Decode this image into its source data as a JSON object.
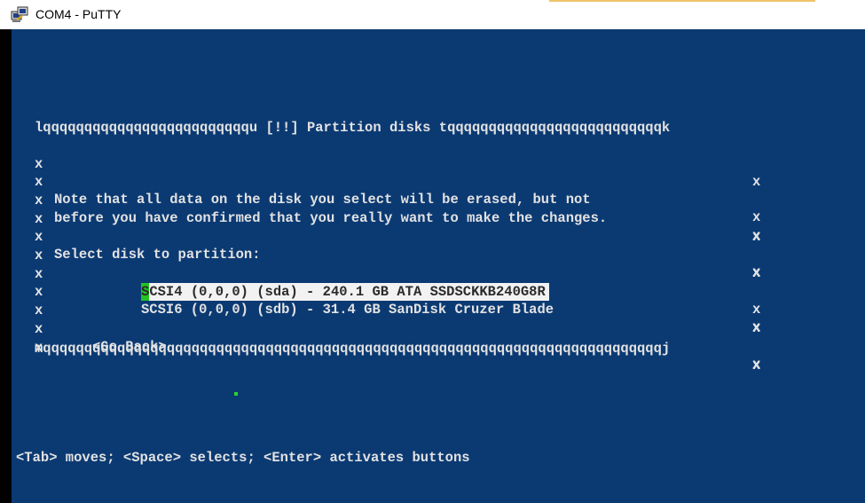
{
  "window": {
    "title": "COM4 - PuTTY"
  },
  "dialog": {
    "top_border": "lqqqqqqqqqqqqqqqqqqqqqqqqqu [!!] Partition disks tqqqqqqqqqqqqqqqqqqqqqqqqqqk",
    "bottom_border": "mqqqqqqqqqqqqqqqqqqqqqqqqqqqqqqqqqqqqqqqqqqqqqqqqqqqqqqqqqqqqqqqqqqqqqqqqqqqj",
    "side_char": "x",
    "note_line_1": "Note that all data on the disk you select will be erased, but not",
    "note_line_2": "before you have confirmed that you really want to make the changes.",
    "prompt": "Select disk to partition:",
    "disks": [
      {
        "cursor_char": "S",
        "rest": "CSI4 (0,0,0) (sda) - 240.1 GB ATA SSDSCKKB240G8R"
      },
      {
        "label": "SCSI6 (0,0,0) (sdb) - 31.4 GB SanDisk Cruzer Blade"
      }
    ],
    "go_back": "<Go Back>"
  },
  "status_bar": {
    "help": "<Tab> moves; <Space> selects; <Enter> activates buttons"
  },
  "colors": {
    "terminal_bg": "#0b3a73",
    "terminal_fg": "#e2e2e2",
    "selection_bg": "#f2f2f2",
    "cursor": "#22c322"
  }
}
